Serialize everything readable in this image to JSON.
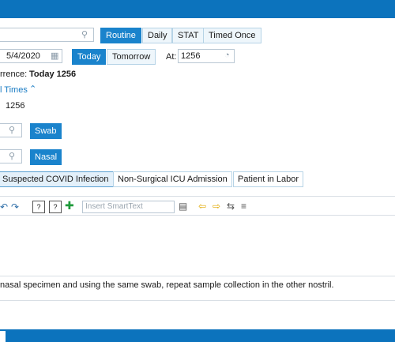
{
  "priority": {
    "options": [
      "Routine",
      "Daily",
      "STAT",
      "Timed Once"
    ],
    "selected": "Routine"
  },
  "schedule": {
    "date": "5/4/2020",
    "today_label": "Today",
    "tomorrow_label": "Tomorrow",
    "at_label": "At:",
    "time_value": "1256"
  },
  "occurrence": {
    "prefix": "rrence:",
    "value": "Today 1256",
    "additional_times_label": "l Times",
    "time_entry": "1256"
  },
  "specimen": {
    "source_button": "Swab",
    "site_button": "Nasal"
  },
  "reasons": {
    "options": [
      "Suspected COVID Infection",
      "Non-Surgical ICU Admission",
      "Patient in Labor"
    ],
    "selected": "Suspected COVID Infection"
  },
  "editor": {
    "smarttext_placeholder": "Insert SmartText"
  },
  "instructions": {
    "text": "nasal specimen and using the same swab, repeat sample collection in the other nostril."
  },
  "colors": {
    "brand_blue": "#0c73bd",
    "button_blue": "#1a83cc"
  }
}
